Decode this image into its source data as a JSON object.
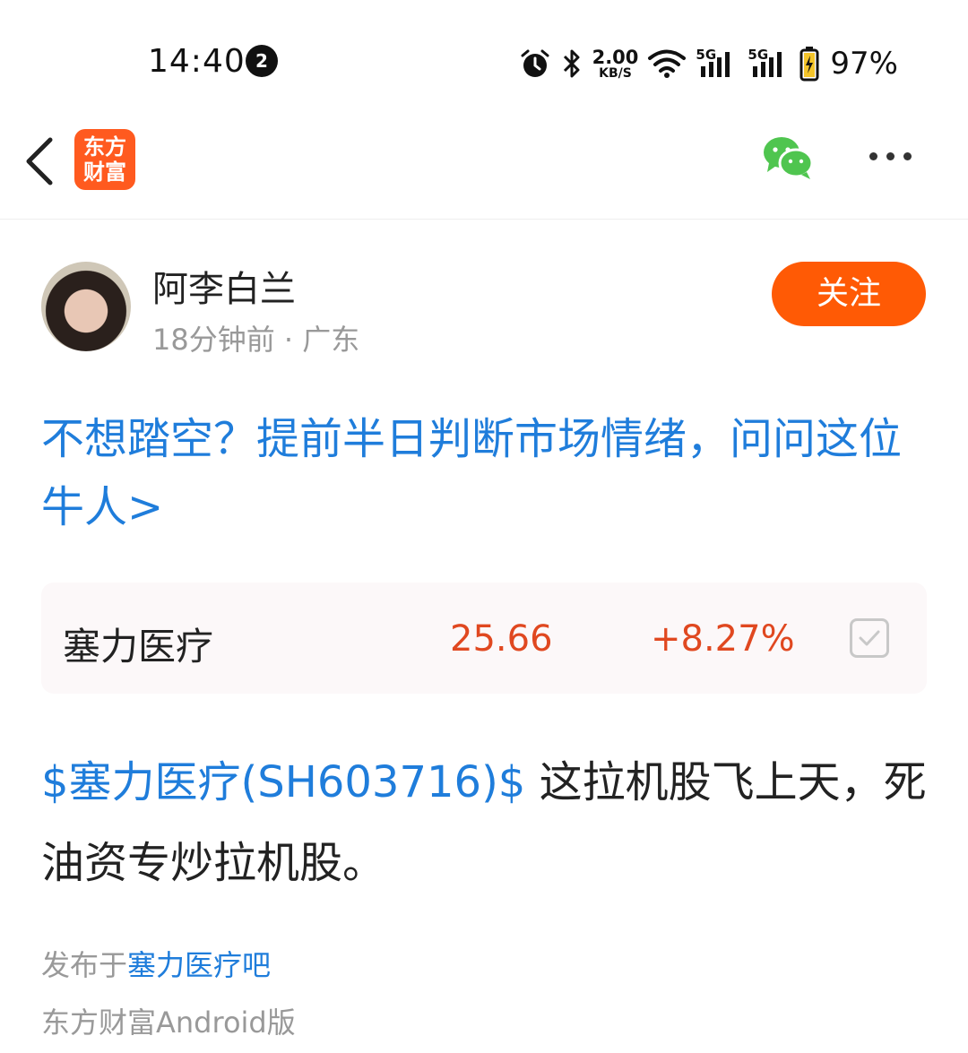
{
  "status_bar": {
    "time": "14:40",
    "notification_count": "2",
    "net_speed_value": "2.00",
    "net_speed_unit": "KB/S",
    "signal1_label": "5G",
    "signal2_label": "5G",
    "battery_percent": "97%"
  },
  "nav": {
    "logo_line1": "东方",
    "logo_line2": "财富"
  },
  "author": {
    "name": "阿李白兰",
    "meta": "18分钟前 · 广东",
    "follow_label": "关注"
  },
  "promo": {
    "text": "不想踏空？提前半日判断市场情绪，问问这位牛人>"
  },
  "stock_card": {
    "name": "塞力医疗",
    "price": "25.66",
    "change": "+8.27%"
  },
  "post": {
    "stock_tag": "$塞力医疗(SH603716)$",
    "text": " 这拉机股飞上天，死油资专炒拉机股。"
  },
  "footer": {
    "published_prefix": "发布于",
    "bar_name": "塞力医疗吧",
    "client": "东方财富Android版"
  },
  "colors": {
    "brand_orange": "#ff5a05",
    "link_blue": "#1f7ddb",
    "price_red": "#e04820",
    "wechat_green": "#4fc54f"
  }
}
